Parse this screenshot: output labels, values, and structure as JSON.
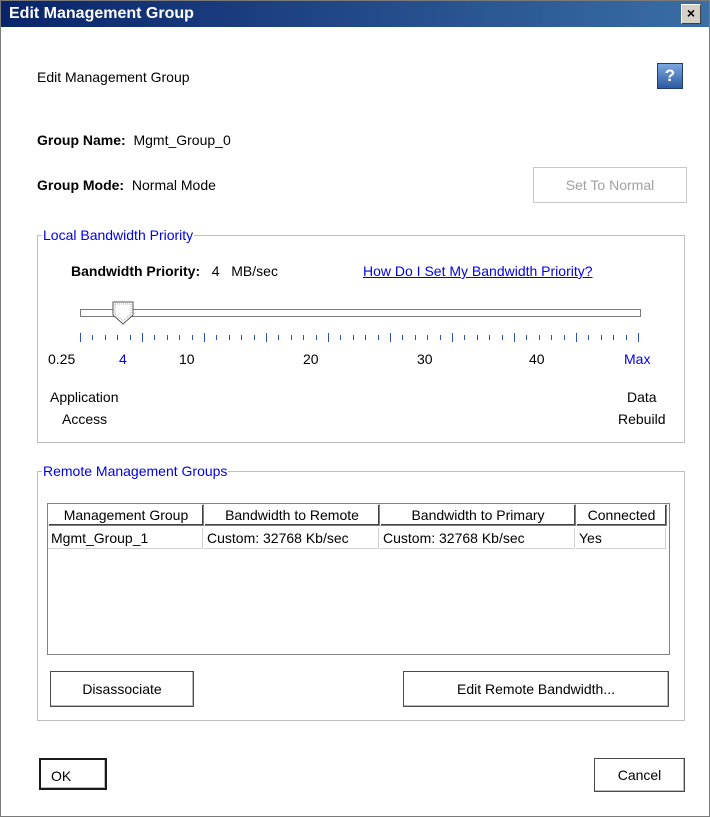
{
  "window": {
    "title": "Edit Management Group",
    "close_label": "×"
  },
  "header": {
    "subtitle": "Edit Management Group",
    "help_label": "?"
  },
  "group": {
    "name_label": "Group Name:",
    "name_value": "Mgmt_Group_0",
    "mode_label": "Group Mode:",
    "mode_value": "Normal Mode",
    "set_normal_label": "Set To Normal"
  },
  "bandwidth": {
    "legend": "Local Bandwidth Priority",
    "priority_label": "Bandwidth Priority:",
    "priority_value": "4",
    "priority_unit": "MB/sec",
    "help_link": "How Do I Set My Bandwidth Priority?",
    "slider_value": 4,
    "tick_labels": [
      "0.25",
      "4",
      "10",
      "20",
      "30",
      "40",
      "Max"
    ],
    "left_caption_line1": "Application",
    "left_caption_line2": "Access",
    "right_caption_line1": "Data",
    "right_caption_line2": "Rebuild",
    "accent_color": "#0000ee"
  },
  "remote": {
    "legend": "Remote Management Groups",
    "columns": [
      "Management Group",
      "Bandwidth to Remote",
      "Bandwidth to Primary",
      "Connected"
    ],
    "rows": [
      [
        "Mgmt_Group_1",
        "Custom: 32768 Kb/sec",
        "Custom: 32768 Kb/sec",
        "Yes"
      ]
    ],
    "disassociate_label": "Disassociate",
    "edit_bandwidth_label": "Edit Remote Bandwidth..."
  },
  "footer": {
    "ok_label": "OK",
    "cancel_label": "Cancel"
  }
}
